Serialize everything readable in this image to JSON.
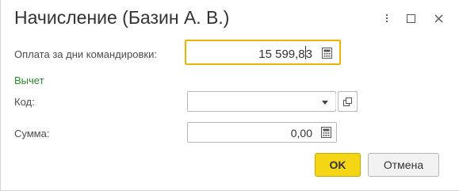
{
  "window": {
    "title": "Начисление (Базин А. В.)",
    "controls": [
      "more-icon",
      "maximize-icon",
      "close-icon"
    ]
  },
  "form": {
    "payment": {
      "label": "Оплата за дни командировки:",
      "value_before_caret": "15 599,8",
      "value_after_caret": "3"
    },
    "section_title": "Вычет",
    "code": {
      "label": "Код:",
      "value": ""
    },
    "sum": {
      "label": "Сумма:",
      "value": "0,00"
    }
  },
  "buttons": {
    "ok": "OK",
    "cancel": "Отмена"
  },
  "colors": {
    "focus_border": "#f0b400",
    "section_text": "#2a8c2a",
    "ok_button": "#f5d615"
  }
}
